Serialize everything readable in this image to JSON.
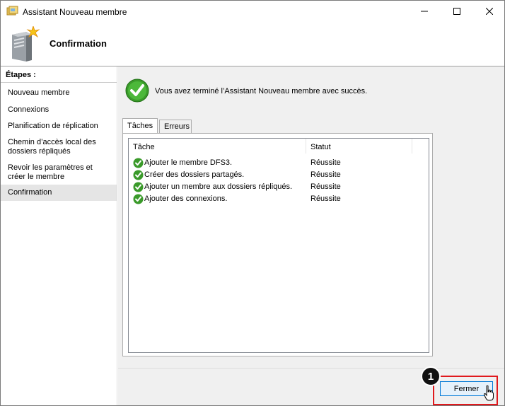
{
  "window": {
    "title": "Assistant Nouveau membre",
    "minimize_icon": "minimize-icon",
    "maximize_icon": "maximize-icon",
    "close_icon": "close-icon"
  },
  "header": {
    "title": "Confirmation",
    "icon": "server-wizard-icon"
  },
  "steps": {
    "title": "Étapes :",
    "items": [
      {
        "label": "Nouveau membre"
      },
      {
        "label": "Connexions"
      },
      {
        "label": "Planification de réplication"
      },
      {
        "label": "Chemin d’accès local des dossiers répliqués"
      },
      {
        "label": "Revoir les paramètres et créer le membre"
      },
      {
        "label": "Confirmation",
        "active": true
      }
    ]
  },
  "content": {
    "success_message": "Vous avez terminé l’Assistant Nouveau membre avec succès.",
    "tabs": [
      {
        "label": "Tâches",
        "active": true
      },
      {
        "label": "Erreurs"
      }
    ],
    "table": {
      "columns": [
        "Tâche",
        "Statut"
      ],
      "rows": [
        {
          "task": "Ajouter le membre DFS3.",
          "status": "Réussite"
        },
        {
          "task": "Créer des dossiers partagés.",
          "status": "Réussite"
        },
        {
          "task": "Ajouter un membre aux dossiers répliqués.",
          "status": "Réussite"
        },
        {
          "task": "Ajouter des connexions.",
          "status": "Réussite"
        }
      ]
    }
  },
  "footer": {
    "close_label": "Fermer"
  },
  "annotation": {
    "badge_number": "1",
    "highlight_color": "#e0191d"
  },
  "colors": {
    "success_green": "#3a9a2a",
    "button_focus_border": "#0078d7",
    "content_bg": "#f0f0f0"
  }
}
